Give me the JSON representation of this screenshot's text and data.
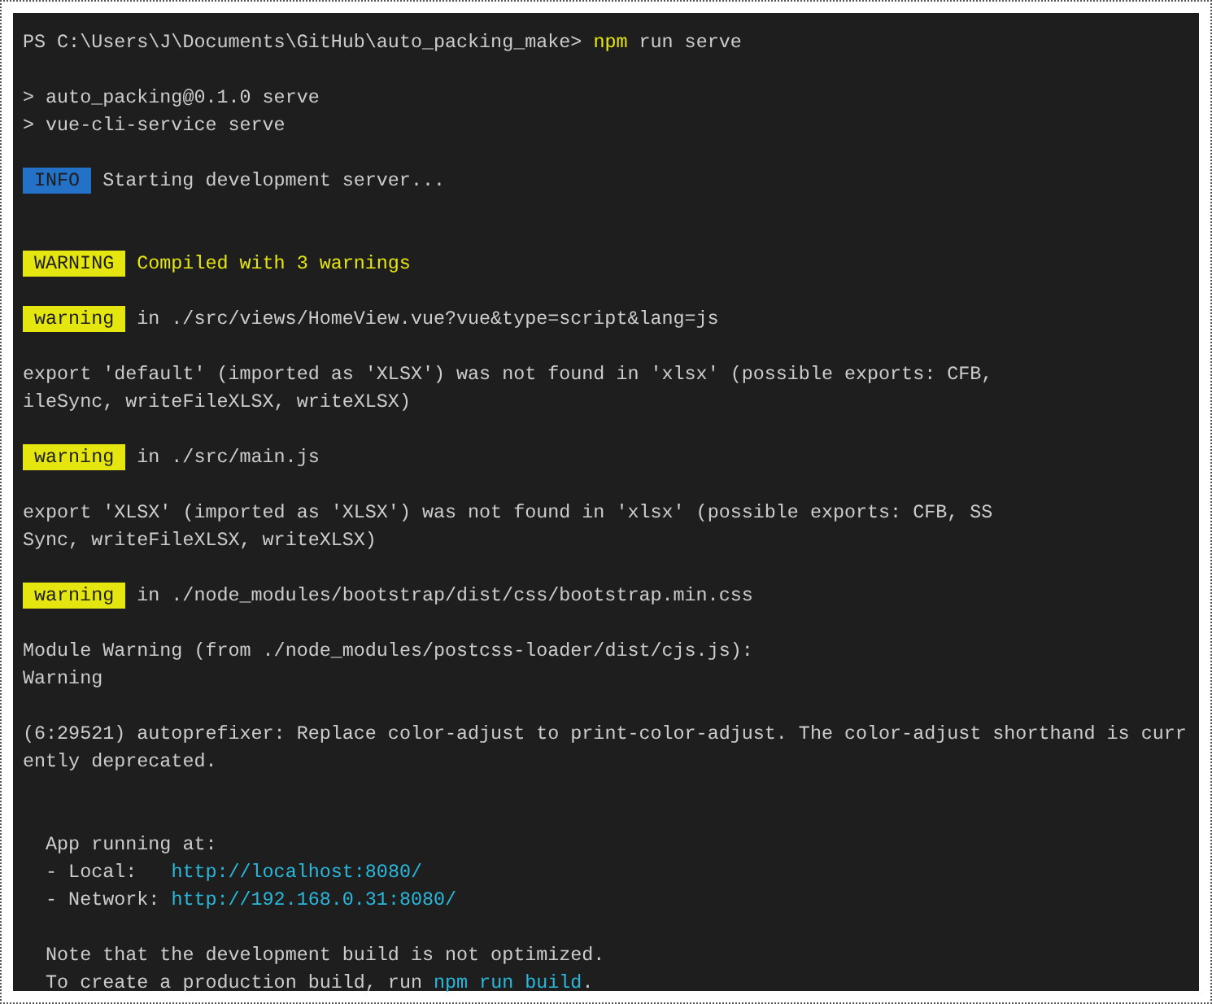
{
  "terminal": {
    "lines": [
      {
        "kind": "text",
        "parts": [
          {
            "kind": "text",
            "text": "PS C:\\Users\\J\\Documents\\GitHub\\auto_packing_make> "
          },
          {
            "kind": "command",
            "text": "npm"
          },
          {
            "kind": "text",
            "text": " run serve"
          }
        ]
      },
      {
        "kind": "blank"
      },
      {
        "kind": "text",
        "parts": [
          {
            "kind": "text",
            "text": "> auto_packing@0.1.0 serve"
          }
        ]
      },
      {
        "kind": "text",
        "parts": [
          {
            "kind": "text",
            "text": "> vue-cli-service serve"
          }
        ]
      },
      {
        "kind": "blank"
      },
      {
        "kind": "text",
        "parts": [
          {
            "kind": "info-badge",
            "text": "INFO"
          },
          {
            "kind": "text",
            "text": " Starting development server..."
          }
        ]
      },
      {
        "kind": "blank"
      },
      {
        "kind": "blank"
      },
      {
        "kind": "text",
        "parts": [
          {
            "kind": "warning-badge",
            "text": "WARNING"
          },
          {
            "kind": "warning",
            "text": " Compiled with 3 warnings"
          }
        ]
      },
      {
        "kind": "blank"
      },
      {
        "kind": "text",
        "parts": [
          {
            "kind": "warning-badge",
            "text": "warning"
          },
          {
            "kind": "text",
            "text": " in ./src/views/HomeView.vue?vue&type=script&lang=js"
          }
        ]
      },
      {
        "kind": "blank"
      },
      {
        "kind": "text",
        "parts": [
          {
            "kind": "text",
            "text": "export 'default' (imported as 'XLSX') was not found in 'xlsx' (possible exports: CFB,"
          }
        ]
      },
      {
        "kind": "text",
        "parts": [
          {
            "kind": "text",
            "text": "ileSync, writeFileXLSX, writeXLSX)"
          }
        ]
      },
      {
        "kind": "blank"
      },
      {
        "kind": "text",
        "parts": [
          {
            "kind": "warning-badge",
            "text": "warning"
          },
          {
            "kind": "text",
            "text": " in ./src/main.js"
          }
        ]
      },
      {
        "kind": "blank"
      },
      {
        "kind": "text",
        "parts": [
          {
            "kind": "text",
            "text": "export 'XLSX' (imported as 'XLSX') was not found in 'xlsx' (possible exports: CFB, SS"
          }
        ]
      },
      {
        "kind": "text",
        "parts": [
          {
            "kind": "text",
            "text": "Sync, writeFileXLSX, writeXLSX)"
          }
        ]
      },
      {
        "kind": "blank"
      },
      {
        "kind": "text",
        "parts": [
          {
            "kind": "warning-badge",
            "text": "warning"
          },
          {
            "kind": "text",
            "text": " in ./node_modules/bootstrap/dist/css/bootstrap.min.css"
          }
        ]
      },
      {
        "kind": "blank"
      },
      {
        "kind": "text",
        "parts": [
          {
            "kind": "text",
            "text": "Module Warning (from ./node_modules/postcss-loader/dist/cjs.js):"
          }
        ]
      },
      {
        "kind": "text",
        "parts": [
          {
            "kind": "text",
            "text": "Warning"
          }
        ]
      },
      {
        "kind": "blank"
      },
      {
        "kind": "text",
        "parts": [
          {
            "kind": "text",
            "text": "(6:29521) autoprefixer: Replace color-adjust to print-color-adjust. The color-adjust shorthand is curr"
          }
        ]
      },
      {
        "kind": "text",
        "parts": [
          {
            "kind": "text",
            "text": "ently deprecated."
          }
        ]
      },
      {
        "kind": "blank"
      },
      {
        "kind": "blank"
      },
      {
        "kind": "text",
        "parts": [
          {
            "kind": "text",
            "text": "  App running at:"
          }
        ]
      },
      {
        "kind": "text",
        "parts": [
          {
            "kind": "text",
            "text": "  - Local:   "
          },
          {
            "kind": "link",
            "text": "http://localhost:8080/"
          }
        ]
      },
      {
        "kind": "text",
        "parts": [
          {
            "kind": "text",
            "text": "  - Network: "
          },
          {
            "kind": "link",
            "text": "http://192.168.0.31:8080/"
          }
        ]
      },
      {
        "kind": "blank"
      },
      {
        "kind": "text",
        "parts": [
          {
            "kind": "text",
            "text": "  Note that the development build is not optimized."
          }
        ]
      },
      {
        "kind": "text",
        "parts": [
          {
            "kind": "text",
            "text": "  To create a production build, run "
          },
          {
            "kind": "link",
            "text": "npm run build"
          },
          {
            "kind": "text",
            "text": "."
          }
        ]
      }
    ]
  }
}
